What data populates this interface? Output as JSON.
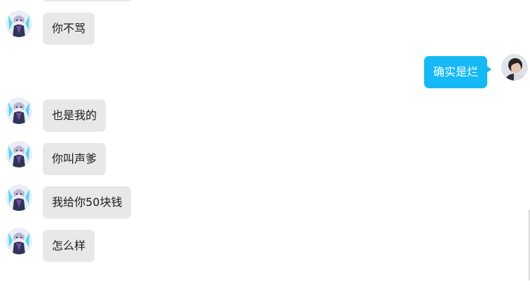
{
  "messages": [
    {
      "side": "other",
      "text": "你不骂"
    },
    {
      "side": "self",
      "text": "确实是烂"
    },
    {
      "side": "other",
      "text": "也是我的"
    },
    {
      "side": "other",
      "text": "你叫声爹"
    },
    {
      "side": "other",
      "text": "我给你50块钱"
    },
    {
      "side": "other",
      "text": "怎么样"
    }
  ],
  "colors": {
    "other_bubble": "#e8e8e8",
    "self_bubble": "#16b8f5",
    "self_text": "#ffffff",
    "other_text": "#1a1a1a"
  },
  "avatars": {
    "other": "anime-character-avatar",
    "self": "user-photo-avatar"
  }
}
